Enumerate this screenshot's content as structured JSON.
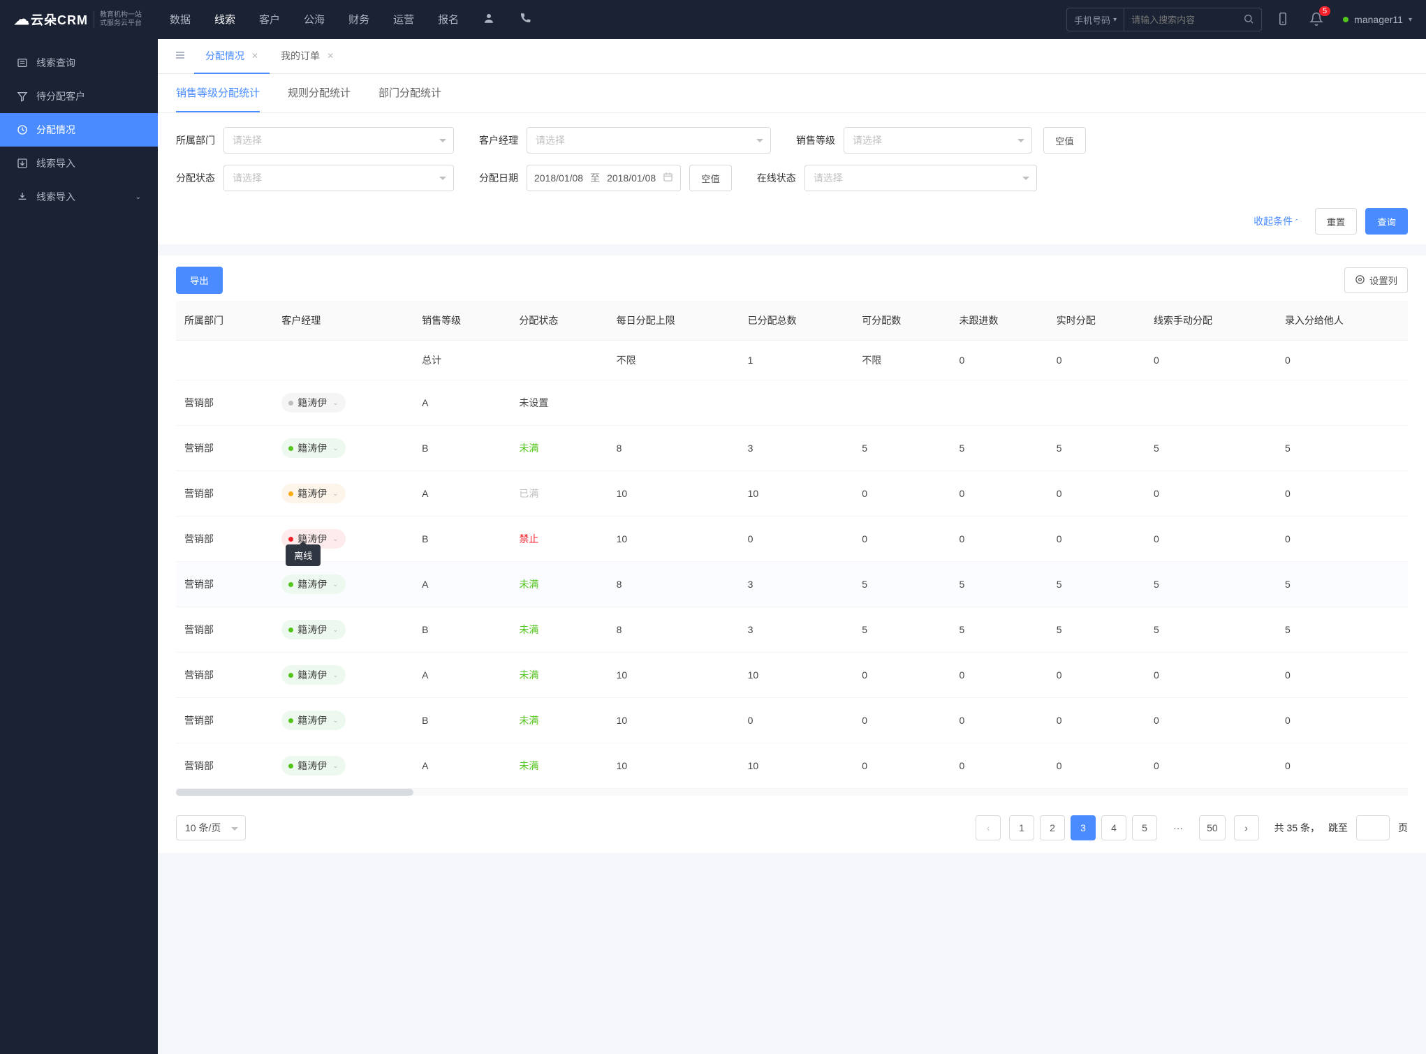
{
  "brand": {
    "name": "云朵CRM",
    "subtitle1": "教育机构一站",
    "subtitle2": "式服务云平台"
  },
  "topmenu": [
    "数据",
    "线索",
    "客户",
    "公海",
    "财务",
    "运营",
    "报名"
  ],
  "active_topmenu": 1,
  "search": {
    "type": "手机号码",
    "placeholder": "请输入搜索内容"
  },
  "notifications": {
    "count": "5"
  },
  "user": {
    "name": "manager11"
  },
  "sidebar": {
    "items": [
      {
        "icon": "list-icon",
        "label": "线索查询"
      },
      {
        "icon": "filter-icon",
        "label": "待分配客户"
      },
      {
        "icon": "clock-icon",
        "label": "分配情况",
        "active": true
      },
      {
        "icon": "import-icon",
        "label": "线索导入"
      },
      {
        "icon": "import2-icon",
        "label": "线索导入",
        "expandable": true
      }
    ]
  },
  "pagetabs": [
    {
      "label": "分配情况",
      "closable": true,
      "active": true
    },
    {
      "label": "我的订单",
      "closable": true
    }
  ],
  "subtabs": [
    "销售等级分配统计",
    "规则分配统计",
    "部门分配统计"
  ],
  "active_subtab": 0,
  "filters": {
    "dept_label": "所属部门",
    "dept_ph": "请选择",
    "mgr_label": "客户经理",
    "mgr_ph": "请选择",
    "level_label": "销售等级",
    "level_ph": "请选择",
    "empty_btn": "空值",
    "status_label": "分配状态",
    "status_ph": "请选择",
    "date_label": "分配日期",
    "date_from": "2018/01/08",
    "date_sep": "至",
    "date_to": "2018/01/08",
    "online_label": "在线状态",
    "online_ph": "请选择",
    "collapse": "收起条件",
    "reset": "重置",
    "query": "查询"
  },
  "toolbar": {
    "export": "导出",
    "columns": "设置列"
  },
  "table": {
    "columns": [
      "所属部门",
      "客户经理",
      "销售等级",
      "分配状态",
      "每日分配上限",
      "已分配总数",
      "可分配数",
      "未跟进数",
      "实时分配",
      "线索手动分配",
      "录入分给他人"
    ],
    "summary": {
      "label": "总计",
      "limit": "不限",
      "total": "1",
      "avail": "不限",
      "nf": "0",
      "rt": "0",
      "man": "0",
      "oth": "0"
    },
    "rows": [
      {
        "dept": "营销部",
        "mgr": "籍涛伊",
        "tag": "gray",
        "level": "A",
        "status": "未设置",
        "statusCls": "",
        "limit": "",
        "total": "",
        "avail": "",
        "nf": "",
        "rt": "",
        "man": "",
        "oth": ""
      },
      {
        "dept": "营销部",
        "mgr": "籍涛伊",
        "tag": "green",
        "level": "B",
        "status": "未满",
        "statusCls": "status-green",
        "limit": "8",
        "total": "3",
        "avail": "5",
        "nf": "5",
        "rt": "5",
        "man": "5",
        "oth": "5"
      },
      {
        "dept": "营销部",
        "mgr": "籍涛伊",
        "tag": "orange",
        "level": "A",
        "status": "已满",
        "statusCls": "status-gray",
        "limit": "10",
        "total": "10",
        "avail": "0",
        "nf": "0",
        "rt": "0",
        "man": "0",
        "oth": "0"
      },
      {
        "dept": "营销部",
        "mgr": "籍涛伊",
        "tag": "red",
        "level": "B",
        "status": "禁止",
        "statusCls": "status-red",
        "limit": "10",
        "total": "0",
        "avail": "0",
        "nf": "0",
        "rt": "0",
        "man": "0",
        "oth": "0",
        "tooltip": "离线"
      },
      {
        "dept": "营销部",
        "mgr": "籍涛伊",
        "tag": "green",
        "level": "A",
        "status": "未满",
        "statusCls": "status-green",
        "limit": "8",
        "total": "3",
        "avail": "5",
        "nf": "5",
        "rt": "5",
        "man": "5",
        "oth": "5",
        "hover": true
      },
      {
        "dept": "营销部",
        "mgr": "籍涛伊",
        "tag": "green",
        "level": "B",
        "status": "未满",
        "statusCls": "status-green",
        "limit": "8",
        "total": "3",
        "avail": "5",
        "nf": "5",
        "rt": "5",
        "man": "5",
        "oth": "5"
      },
      {
        "dept": "营销部",
        "mgr": "籍涛伊",
        "tag": "green",
        "level": "A",
        "status": "未满",
        "statusCls": "status-green",
        "limit": "10",
        "total": "10",
        "avail": "0",
        "nf": "0",
        "rt": "0",
        "man": "0",
        "oth": "0"
      },
      {
        "dept": "营销部",
        "mgr": "籍涛伊",
        "tag": "green",
        "level": "B",
        "status": "未满",
        "statusCls": "status-green",
        "limit": "10",
        "total": "0",
        "avail": "0",
        "nf": "0",
        "rt": "0",
        "man": "0",
        "oth": "0"
      },
      {
        "dept": "营销部",
        "mgr": "籍涛伊",
        "tag": "green",
        "level": "A",
        "status": "未满",
        "statusCls": "status-green",
        "limit": "10",
        "total": "10",
        "avail": "0",
        "nf": "0",
        "rt": "0",
        "man": "0",
        "oth": "0"
      }
    ]
  },
  "pagination": {
    "perpage": "10 条/页",
    "pages": [
      "1",
      "2",
      "3",
      "4",
      "5"
    ],
    "active": "3",
    "ellipsis": "···",
    "last": "50",
    "total_text": "共 35 条，",
    "jump_label": "跳至",
    "page_suffix": "页"
  }
}
